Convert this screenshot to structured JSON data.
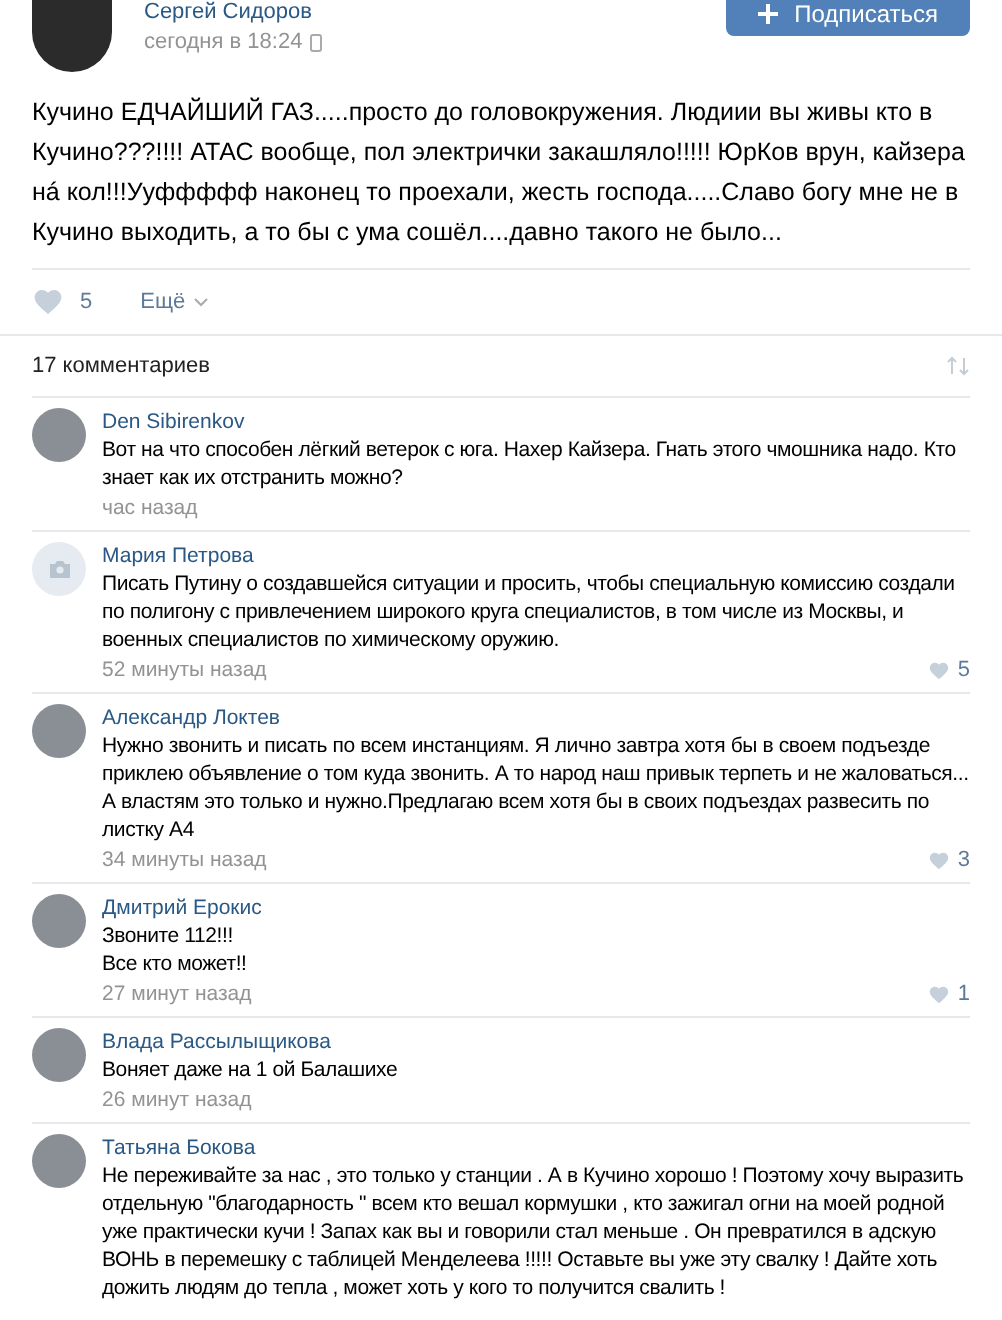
{
  "post": {
    "author": "Сергей Сидоров",
    "time": "сегодня в 18:24",
    "subscribe_button": "Подписаться",
    "text": "Кучино ЕДЧАЙШИЙ ГАЗ.....просто до головокружения. Людиии вы живы кто в Кучино???!!!! АТАС вообще, пол электрички закашляло!!!!! ЮрКов врун, кайзера нá кол!!!Ууффффф наконец то проехали, жесть господа.....Славо богу мне не в Кучино выходить, а то бы с ума сошёл....давно такого не было...",
    "likes": "5",
    "more": "Ещё"
  },
  "comments_header": {
    "count": "17 комментариев"
  },
  "comments": [
    {
      "author": "Den Sibirenkov",
      "kind": "photo",
      "text": "Вот на что способен лёгкий ветерок с юга. Нахер Кайзера. Гнать этого чмошника надо. Кто знает как их отстранить можно?",
      "time": "час назад"
    },
    {
      "author": "Мария Петрова",
      "kind": "camera",
      "text": "Писать Путину о создавшейся ситуации и просить, чтобы специальную комиссию создали по полигону с привлечением широкого круга специалистов, в том числе из Москвы, и военных специалистов по химическому оружию.",
      "time": "52 минуты назад",
      "likes": "5"
    },
    {
      "author": "Александр Локтев",
      "kind": "photo",
      "text": "Нужно звонить и писать по всем инстанциям. Я лично завтра хотя бы в своем подъезде приклею объявление о том куда звонить. А то народ наш привык терпеть и не жаловаться... А властям это только и нужно.Предлагаю всем хотя бы в своих подъездах развесить по листку А4",
      "time": "34 минуты назад",
      "likes": "3"
    },
    {
      "author": "Дмитрий Ерокис",
      "kind": "photo",
      "text": "Звоните 112!!!\nВсе кто может!!",
      "time": "27 минут назад",
      "likes": "1"
    },
    {
      "author": "Влада Рассылыщикова",
      "kind": "photo",
      "text": "Воняет даже на 1 ой Балашихе",
      "time": "26 минут назад"
    },
    {
      "author": "Татьяна Бокова",
      "kind": "photo",
      "text": "Не переживайте за нас , это только у станции . А в Кучино хорошо ! Поэтому хочу выразить отдельную \"благодарность \" всем кто вешал кормушки , кто зажигал огни на моей родной уже практически кучи ! Запах как вы и говорили стал меньше . Он превратился в адскую ВОНЬ в перемешку с таблицей Менделеева !!!!! Оставьте вы уже эту свалку ! Дайте хоть дожить людям до тепла , может хоть у кого то получится свалить !"
    }
  ]
}
